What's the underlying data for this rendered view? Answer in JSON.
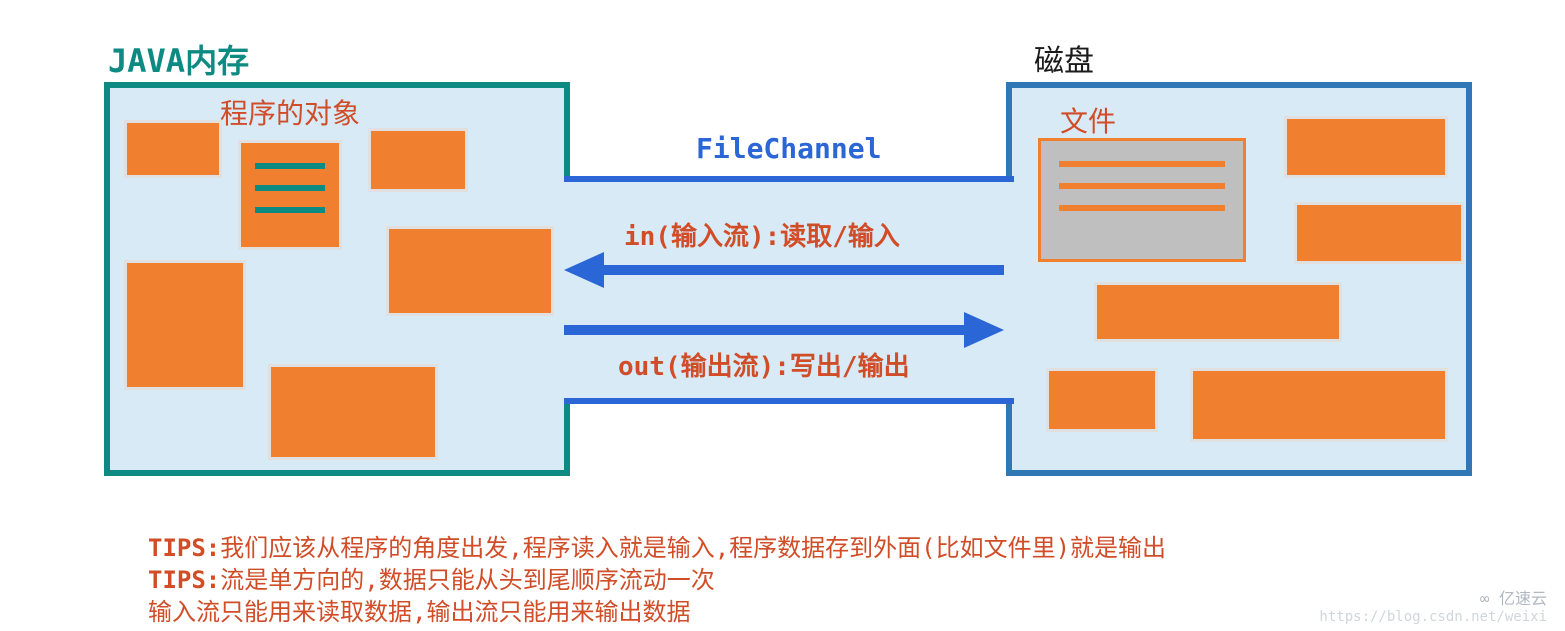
{
  "titles": {
    "left": "JAVA内存",
    "right": "磁盘",
    "objects": "程序的对象",
    "file": "文件"
  },
  "channel": {
    "title": "FileChannel",
    "in_label": "in(输入流):读取/输入",
    "out_label": "out(输出流):写出/输出"
  },
  "tips": {
    "line1_prefix": "TIPS:",
    "line1": "我们应该从程序的角度出发,程序读入就是输入,程序数据存到外面(比如文件里)就是输出",
    "line2_prefix": "TIPS:",
    "line2": "流是单方向的,数据只能从头到尾顺序流动一次",
    "line3": "输入流只能用来读取数据,输出流只能用来输出数据"
  },
  "colors": {
    "teal": "#0d8a82",
    "blue_border": "#2f77b5",
    "panel_bg": "#d9eaf7",
    "block": "#f08030",
    "arrow": "#2a66d6",
    "red_text": "#d04d28"
  },
  "watermark": {
    "url": "https://blog.csdn.net/weixi",
    "brand": "亿速云"
  }
}
